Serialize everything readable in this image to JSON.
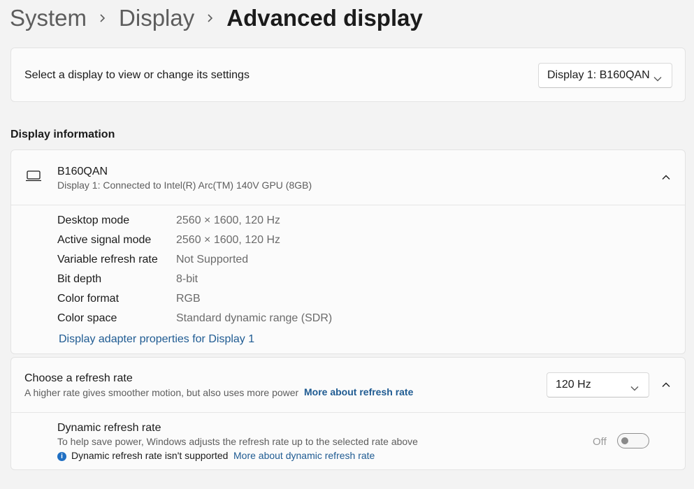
{
  "breadcrumb": {
    "items": [
      "System",
      "Display"
    ],
    "current": "Advanced display"
  },
  "select_display": {
    "label": "Select a display to view or change its settings",
    "dropdown_value": "Display 1: B160QAN"
  },
  "display_information": {
    "heading": "Display information",
    "monitor_name": "B160QAN",
    "monitor_subtitle": "Display 1: Connected to Intel(R) Arc(TM) 140V GPU (8GB)",
    "rows": [
      {
        "label": "Desktop mode",
        "value": "2560 × 1600, 120 Hz"
      },
      {
        "label": "Active signal mode",
        "value": "2560 × 1600, 120 Hz"
      },
      {
        "label": "Variable refresh rate",
        "value": "Not Supported"
      },
      {
        "label": "Bit depth",
        "value": "8-bit"
      },
      {
        "label": "Color format",
        "value": "RGB"
      },
      {
        "label": "Color space",
        "value": "Standard dynamic range (SDR)"
      }
    ],
    "adapter_link": "Display adapter properties for Display 1"
  },
  "refresh_rate": {
    "title": "Choose a refresh rate",
    "description": "A higher rate gives smoother motion, but also uses more power",
    "more_link": "More about refresh rate",
    "dropdown_value": "120 Hz"
  },
  "dynamic_refresh": {
    "title": "Dynamic refresh rate",
    "description": "To help save power, Windows adjusts the refresh rate up to the selected rate above",
    "not_supported": "Dynamic refresh rate isn't supported",
    "more_link": "More about dynamic refresh rate",
    "toggle_label": "Off",
    "toggle_on": false
  },
  "icons": {
    "breadcrumb_separator": "chevron-right-icon",
    "dropdown": "chevron-down-icon",
    "expander": "chevron-up-icon",
    "monitor": "laptop-icon",
    "info": "info-icon"
  },
  "colors": {
    "background": "#f3f3f3",
    "card": "#fbfbfb",
    "link": "#1f5b92",
    "info": "#1f6fc3"
  }
}
